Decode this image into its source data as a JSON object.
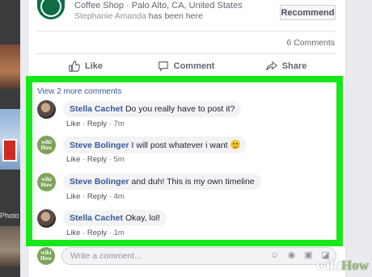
{
  "left_panel": {
    "label": "Photo"
  },
  "post": {
    "place_line": "Coffee Shop · Palo Alto, CA, United States",
    "visitor_name": "Stephanie Amanda",
    "visitor_suffix": "has been here",
    "recommend_label": "Recommend",
    "comments_count": "6 Comments"
  },
  "actions": {
    "like": "Like",
    "comment": "Comment",
    "share": "Share"
  },
  "comments_section": {
    "view_more": "View 2 more comments",
    "highlight_color": "#17e81a",
    "items": [
      {
        "author": "Stella Cachet",
        "text": "Do you really have to post it?",
        "like": "Like",
        "reply": "Reply",
        "time": "7m",
        "avatar": "photo"
      },
      {
        "author": "Steve Bolinger",
        "text": "I will post whatever i want",
        "emoji": "smiley-icon",
        "like": "Like",
        "reply": "Reply",
        "time": "5m",
        "avatar": "wikihow"
      },
      {
        "author": "Steve Bolinger",
        "text": "and duh! This is my own timeline",
        "like": "Like",
        "reply": "Reply",
        "time": "4m",
        "avatar": "wikihow"
      },
      {
        "author": "Stella Cachet",
        "text": "Okay, lol!",
        "like": "Like",
        "reply": "Reply",
        "time": "1m",
        "avatar": "photo"
      }
    ]
  },
  "composer": {
    "placeholder": "Write a comment...",
    "icons": [
      "emoji-icon",
      "camera-icon",
      "gif-icon",
      "sticker-icon"
    ]
  },
  "avatar_text": {
    "line1": "wiki",
    "line2": "How"
  },
  "watermark": {
    "wiki": "wiki",
    "how": "How"
  }
}
